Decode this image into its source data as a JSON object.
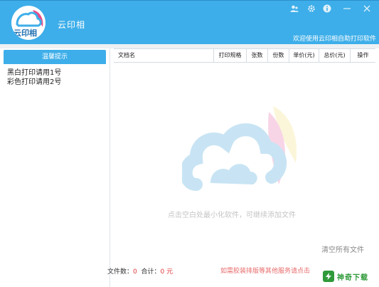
{
  "header": {
    "logo_text": "云印相",
    "app_title": "云印相",
    "welcome": "欢迎使用云印相自助打印软件",
    "controls": [
      {
        "name": "user-icon"
      },
      {
        "name": "gear-icon"
      },
      {
        "name": "info-icon"
      },
      {
        "name": "minimize-icon"
      },
      {
        "name": "close-icon"
      }
    ]
  },
  "sidebar": {
    "tab_label": "温馨提示",
    "tips": [
      "黑白打印请用1号",
      "彩色打印请用2号"
    ]
  },
  "table": {
    "columns": [
      "文档名",
      "打印规格",
      "张数",
      "份数",
      "单价(元)",
      "总价(元)",
      "操作"
    ]
  },
  "drop_area": {
    "hint": "点击空白处最小化软件，可继续添加文件"
  },
  "actions": {
    "clear_all": "清空所有文件"
  },
  "footer": {
    "file_count_label": "文件数：",
    "file_count": "0",
    "total_label": "合计：",
    "total_value": "0",
    "currency": "元",
    "promo": "如需胶装排版等其他服务请点击"
  },
  "badge": {
    "text": "神奇下载"
  },
  "colors": {
    "brand": "#3daee9",
    "accent_red": "#e0373a",
    "promo_red": "#e86c6c"
  }
}
